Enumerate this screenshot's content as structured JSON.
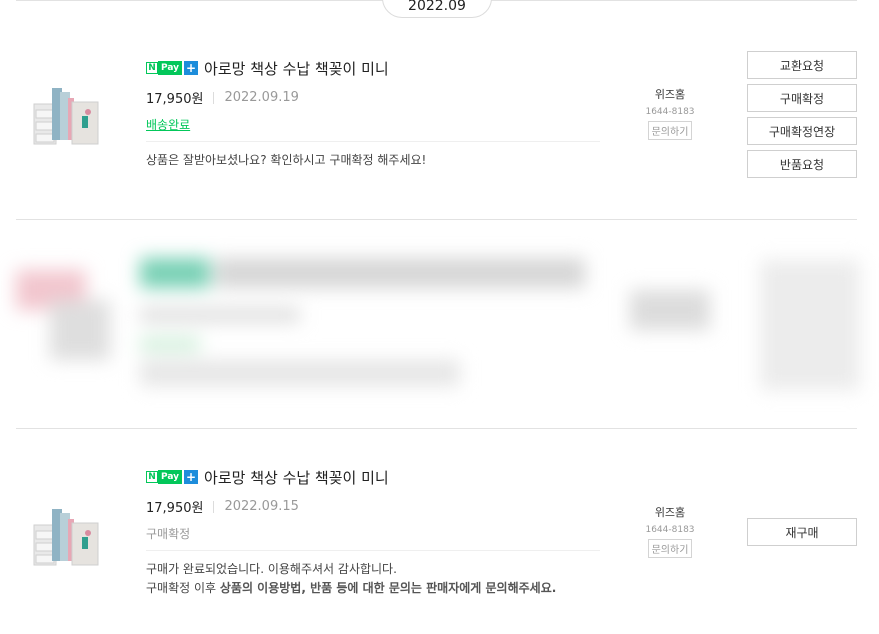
{
  "month_header": "2022.09",
  "badge": {
    "n": "N",
    "pay": "Pay",
    "plus": "+"
  },
  "orders": [
    {
      "product_name": "아로망 책상 수납 책꽂이 미니",
      "price": "17,950원",
      "date": "2022.09.19",
      "status": "배송완료",
      "message_line1": "상품은 잘받아보셨나요? 확인하시고 구매확정 해주세요!",
      "seller": {
        "name": "위즈홈",
        "phone": "1644-8183",
        "inquiry": "문의하기"
      },
      "buttons": [
        "교환요청",
        "구매확정",
        "구매확정연장",
        "반품요청"
      ]
    },
    {
      "product_name": "아로망 책상 수납 책꽂이 미니",
      "price": "17,950원",
      "date": "2022.09.15",
      "status": "구매확정",
      "message_line1": "구매가 완료되었습니다. 이용해주셔서 감사합니다.",
      "message_line2_prefix": "구매확정 이후 ",
      "message_line2_bold": "상품의 이용방법, 반품 등에 대한 문의는 판매자에게 문의해주세요.",
      "seller": {
        "name": "위즈홈",
        "phone": "1644-8183",
        "inquiry": "문의하기"
      },
      "buttons": [
        "재구매"
      ]
    }
  ],
  "colors": {
    "npay_green": "#03c75a",
    "npay_blue": "#1d8ddb",
    "status_green": "#03c75a"
  }
}
